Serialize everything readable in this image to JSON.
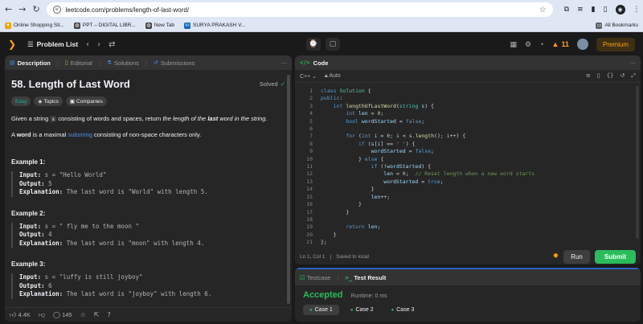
{
  "browser": {
    "url": "leetcode.com/problems/length-of-last-word/",
    "bookmarks": [
      {
        "label": "Online Shopping Sit..."
      },
      {
        "label": "PPT – DIGITAL LIBR..."
      },
      {
        "label": "New Tab"
      },
      {
        "label": "SURYA PRAKASH V..."
      }
    ],
    "all_bookmarks": "All Bookmarks"
  },
  "nav": {
    "problem_list": "Problem List",
    "streak": "11",
    "premium": "Premium"
  },
  "left_tabs": {
    "description": "Description",
    "editorial": "Editorial",
    "solutions": "Solutions",
    "submissions": "Submissions"
  },
  "problem": {
    "title": "58. Length of Last Word",
    "status": "Solved",
    "badges": {
      "difficulty": "Easy",
      "topics": "Topics",
      "companies": "Companies"
    },
    "para1": {
      "a": "Given a string ",
      "code": "s",
      "b": " consisting of words and spaces, return ",
      "em1": "the length of the ",
      "bold": "last",
      "em2": " word in the string."
    },
    "para2": {
      "a": "A ",
      "bold": "word",
      "b": " is a maximal ",
      "link": "substring",
      "c": " consisting of non-space characters only."
    },
    "labels": {
      "input": "Input:",
      "output": "Output:",
      "explanation": "Explanation:"
    },
    "examples": [
      {
        "title": "Example 1:",
        "input": "s = \"Hello World\"",
        "output": "5",
        "explanation": "The last word is \"World\" with length 5."
      },
      {
        "title": "Example 2:",
        "input": "s = \"   fly me   to   the moon  \"",
        "output": "4",
        "explanation": "The last word is \"moon\" with length 4."
      },
      {
        "title": "Example 3:",
        "input": "s = \"luffy is still joyboy\"",
        "output": "6",
        "explanation": "The last word is \"joyboy\" with length 6."
      }
    ],
    "likes": "4.4K",
    "comments": "145"
  },
  "code": {
    "header": "Code",
    "language": "C++",
    "mode": "Auto",
    "cursor": "Ln 1, Col 1",
    "saved": "Saved to local",
    "run": "Run",
    "submit": "Submit",
    "lines": [
      {
        "n": "1"
      },
      {
        "n": "2"
      },
      {
        "n": "3"
      },
      {
        "n": "4"
      },
      {
        "n": "5"
      },
      {
        "n": "6"
      },
      {
        "n": "7"
      },
      {
        "n": "8"
      },
      {
        "n": "9"
      },
      {
        "n": "10"
      },
      {
        "n": "11"
      },
      {
        "n": "12"
      },
      {
        "n": "13"
      },
      {
        "n": "14"
      },
      {
        "n": "15"
      },
      {
        "n": "16"
      },
      {
        "n": "17"
      },
      {
        "n": "18"
      },
      {
        "n": "19"
      },
      {
        "n": "20"
      },
      {
        "n": "21"
      }
    ]
  },
  "result": {
    "testcase_tab": "Testcase",
    "result_tab": "Test Result",
    "verdict": "Accepted",
    "runtime": "Runtime: 0 ms",
    "cases": [
      "Case 1",
      "Case 2",
      "Case 3"
    ]
  },
  "colors": {
    "accent_green": "#2cbb5d",
    "brand_orange": "#ffa116",
    "link_blue": "#4d8fe6"
  }
}
